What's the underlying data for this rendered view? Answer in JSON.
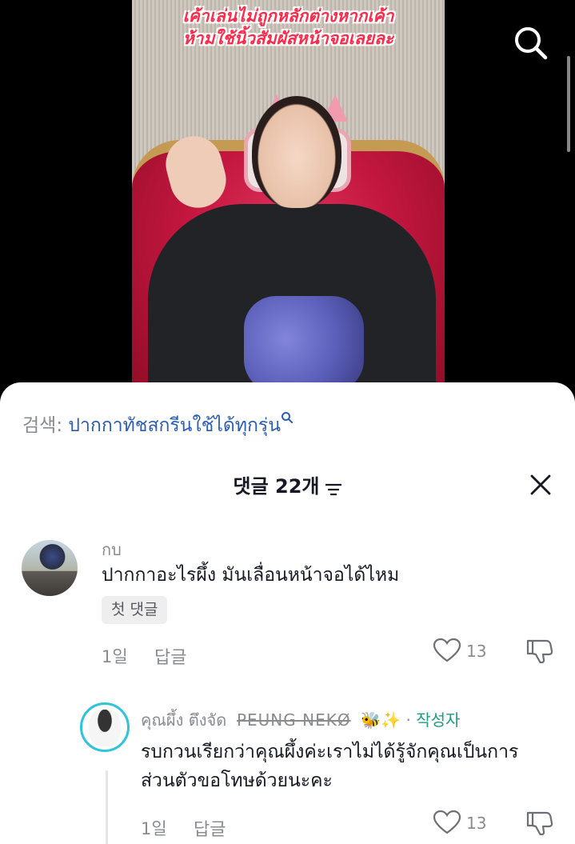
{
  "video": {
    "caption_line1": "เค้าเล่นไม่ถูกหลักต่างหากเค้า",
    "caption_line2": "ห้ามใช้นิ้วสัมผัสหน้าจอเลยละ",
    "search_icon": "search-icon"
  },
  "comments_sheet": {
    "search_label": "검색:",
    "search_term": "ปากกาทัชสกรีนใช้ได้ทุกรุ่น",
    "title": "댓글 22개",
    "sort_icon": "sort-icon",
    "close_icon": "close-icon",
    "comments": [
      {
        "username": "กบ",
        "text": "ปากกาอะไรผึ้ง มันเลื่อนหน้าจอได้ไหม",
        "badge": "첫 댓글",
        "time": "1일",
        "reply_label": "답글",
        "like_count": "13"
      }
    ],
    "replies": [
      {
        "name_thai": "คุณผึ้ง ตึงจัด",
        "name_struck": "PEUNG NEKØ",
        "emoji": "🐝✨",
        "separator": "·",
        "author_tag": "작성자",
        "text_line1": "รบกวนเรียกว่าคุณผึ้งค่ะเราไม่ได้รู้จักคุณเป็นการ",
        "text_line2": "ส่วนตัวขอโทษด้วยนะคะ",
        "time": "1일",
        "reply_label": "답글",
        "like_count": "13"
      }
    ]
  }
}
